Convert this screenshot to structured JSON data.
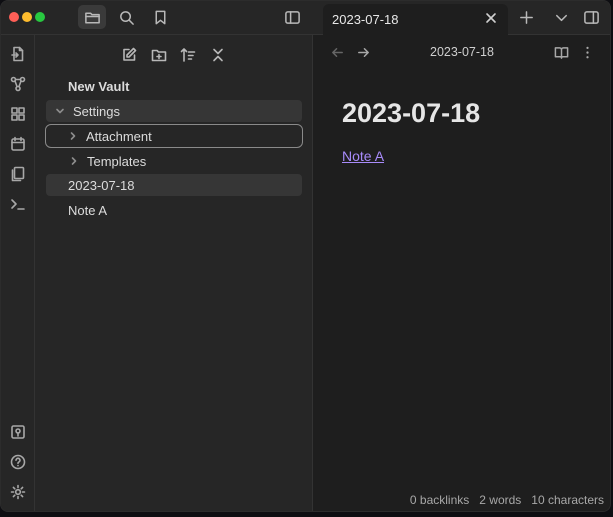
{
  "titlebar": {
    "buttons": {
      "files": "folder-icon",
      "search": "search-icon",
      "bookmarks": "bookmark-icon",
      "sidebar_toggle": "sidebar-toggle-icon"
    },
    "tab": {
      "title": "2023-07-18",
      "close_icon": "close-icon"
    },
    "new_tab_icon": "plus-icon",
    "tab_list_icon": "chevron-down-icon",
    "right_sidebar_icon": "right-sidebar-icon"
  },
  "ribbon": {
    "icons": [
      "open-quick-switcher-icon",
      "graph-view-icon",
      "canvas-icon",
      "daily-note-icon",
      "templates-icon",
      "command-palette-icon",
      "vault-switcher-icon",
      "help-icon",
      "settings-icon"
    ]
  },
  "sidebar": {
    "toolbar": [
      "new-note-icon",
      "new-folder-icon",
      "sort-icon",
      "collapse-all-icon"
    ],
    "vault_name": "New Vault",
    "items": [
      {
        "label": "Settings",
        "type": "folder",
        "expanded": true,
        "selected": true
      },
      {
        "label": "Attachment",
        "type": "folder",
        "expanded": false,
        "focused": true
      },
      {
        "label": "Templates",
        "type": "folder",
        "expanded": false
      },
      {
        "label": "2023-07-18",
        "type": "file",
        "active": true
      },
      {
        "label": "Note A",
        "type": "file"
      }
    ]
  },
  "main": {
    "breadcrumb": "2023-07-18",
    "title": "2023-07-18",
    "link": "Note A",
    "status": {
      "backlinks": "0 backlinks",
      "words": "2 words",
      "characters": "10 characters"
    }
  },
  "colors": {
    "background": "#1e1e1e",
    "sidebar": "#262626",
    "link": "#a88bfa",
    "selection": "#363636"
  }
}
